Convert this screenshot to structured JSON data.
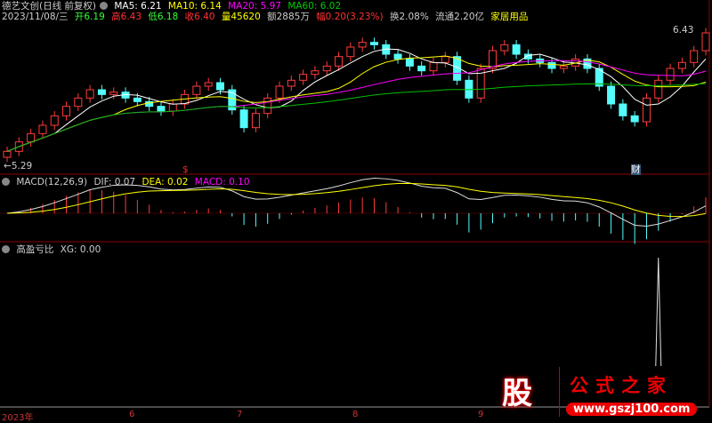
{
  "header": {
    "stock": "德艺文创(日线 前复权)",
    "ma5": "MA5: 6.21",
    "ma10": "MA10: 6.14",
    "ma20": "MA20: 5.97",
    "ma60": "MA60: 6.02",
    "date": "2023/11/08/三",
    "open": "开6.19",
    "high": "高6.43",
    "low": "低6.18",
    "close": "收6.40",
    "vol": "量45620",
    "amount": "额2885万",
    "change": "幅0.20(3.23%)",
    "turnover": "换2.08%",
    "float": "流通2.20亿",
    "industry": "家居用品"
  },
  "price_labels": {
    "max": "6.43",
    "min": "5.29",
    "marker1": "$",
    "marker2": "财"
  },
  "macd_header": {
    "name": "MACD(12,26,9)",
    "dif": "DIF: 0.07",
    "dea": "DEA: 0.02",
    "macd": "MACD: 0.10"
  },
  "xg_header": {
    "name": "高盈亏比",
    "xg": "XG: 0.00"
  },
  "x_axis": [
    "2023年",
    "6",
    "7",
    "8",
    "9"
  ],
  "logo": {
    "icon": "股",
    "name": "公式之家",
    "url": "www.gszj100.com"
  },
  "colors": {
    "up": "#ff3b3b",
    "down": "#54fcfc",
    "ma5": "#ffffff",
    "ma10": "#ffff00",
    "ma20": "#ff00ff",
    "ma60": "#00c000"
  },
  "chart_data": {
    "type": "candlestick",
    "ylim": [
      5.29,
      6.43
    ],
    "close": [
      5.4,
      5.48,
      5.55,
      5.62,
      5.7,
      5.78,
      5.85,
      5.92,
      5.88,
      5.9,
      5.85,
      5.82,
      5.78,
      5.74,
      5.8,
      5.88,
      5.95,
      5.98,
      5.92,
      5.75,
      5.6,
      5.72,
      5.85,
      5.95,
      6.0,
      6.05,
      6.08,
      6.12,
      6.2,
      6.28,
      6.32,
      6.3,
      6.22,
      6.18,
      6.12,
      6.08,
      6.15,
      6.2,
      6.0,
      5.85,
      6.1,
      6.25,
      6.3,
      6.22,
      6.18,
      6.15,
      6.1,
      6.12,
      6.18,
      6.1,
      5.95,
      5.8,
      5.7,
      5.65,
      5.85,
      6.0,
      6.1,
      6.15,
      6.25,
      6.4
    ],
    "xg": [
      0,
      0,
      0,
      0,
      0,
      0,
      0,
      0,
      0,
      0,
      0,
      0,
      0,
      0,
      0,
      0,
      0,
      0,
      0,
      0,
      0,
      0,
      0,
      0,
      0,
      0,
      0,
      0,
      0,
      0,
      0,
      0,
      0,
      0,
      0,
      0,
      0,
      0,
      0,
      0,
      0,
      0,
      0,
      0,
      0,
      0,
      0,
      0,
      0,
      0,
      0,
      0,
      0,
      0,
      0,
      1,
      0,
      0,
      0,
      0
    ]
  }
}
